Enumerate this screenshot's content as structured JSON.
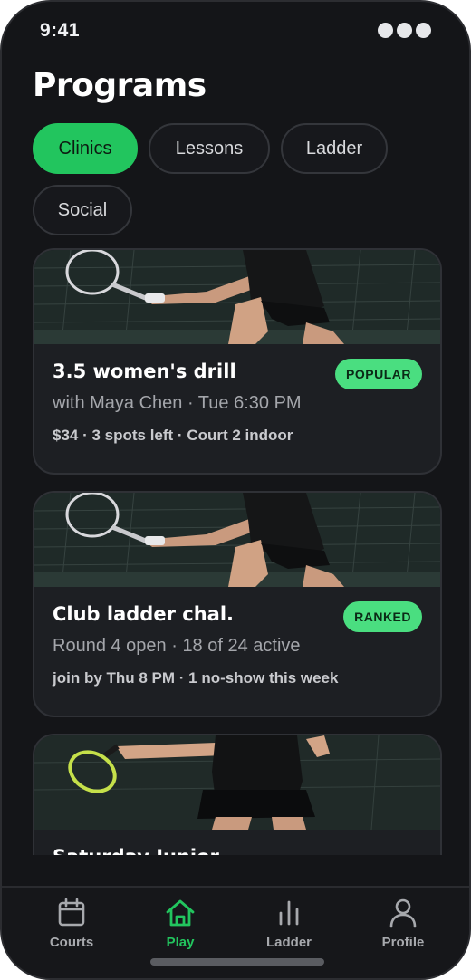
{
  "status_bar": {
    "time": "9:41"
  },
  "header": {
    "title": "Programs"
  },
  "filters": [
    {
      "label": "Clinics",
      "active": true
    },
    {
      "label": "Lessons",
      "active": false
    },
    {
      "label": "Ladder",
      "active": false
    },
    {
      "label": "Social",
      "active": false
    }
  ],
  "cards": [
    {
      "title": "3.5 women's drill",
      "badge": "POPULAR",
      "subtitle": "with Maya Chen · Tue 6:30 PM",
      "meta": "$34 · 3 spots left · Court 2 indoor"
    },
    {
      "title": "Club ladder chal.",
      "badge": "RANKED",
      "subtitle": "Round 4 open · 18 of 24 active",
      "meta": "join by Thu 8 PM · 1 no-show this week"
    },
    {
      "title": "Saturday Junior",
      "badge": "",
      "subtitle": "",
      "meta": ""
    }
  ],
  "tabs": [
    {
      "label": "Courts",
      "icon": "calendar-icon",
      "active": false
    },
    {
      "label": "Play",
      "icon": "home-icon",
      "active": true
    },
    {
      "label": "Ladder",
      "icon": "bar-chart-icon",
      "active": false
    },
    {
      "label": "Profile",
      "icon": "user-icon",
      "active": false
    }
  ],
  "colors": {
    "accent": "#22c55e",
    "badge": "#4ade80",
    "background": "#141518",
    "card": "#1d1f23"
  }
}
